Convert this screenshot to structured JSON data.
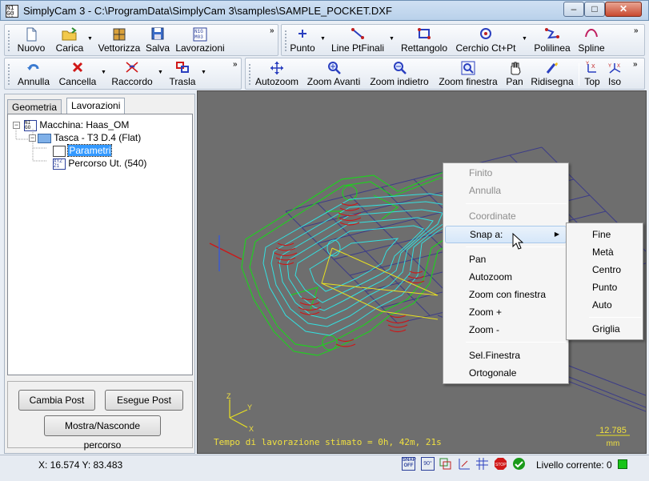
{
  "window": {
    "title": "SimplyCam 3 - C:\\ProgramData\\SimplyCam 3\\samples\\SAMPLE_POCKET.DXF",
    "minimize": "–",
    "maximize": "□",
    "close": "✕"
  },
  "toolbar_file": {
    "items": [
      {
        "label": "Nuovo",
        "icon": "new-file-icon"
      },
      {
        "label": "Carica",
        "icon": "open-folder-icon"
      },
      {
        "label": "Vettorizza",
        "icon": "vectorize-icon"
      },
      {
        "label": "Salva",
        "icon": "save-disk-icon"
      },
      {
        "label": "Lavorazioni",
        "icon": "gcode-icon"
      }
    ]
  },
  "toolbar_draw": {
    "items": [
      {
        "label": "Punto",
        "icon": "point-icon"
      },
      {
        "label": "Line PtFinali",
        "icon": "line-icon"
      },
      {
        "label": "Rettangolo",
        "icon": "rectangle-icon"
      },
      {
        "label": "Cerchio Ct+Pt",
        "icon": "circle-icon"
      },
      {
        "label": "Polilinea",
        "icon": "polyline-icon"
      },
      {
        "label": "Spline",
        "icon": "spline-icon"
      }
    ]
  },
  "toolbar_edit": {
    "items": [
      {
        "label": "Annulla",
        "icon": "undo-icon"
      },
      {
        "label": "Cancella",
        "icon": "delete-icon"
      },
      {
        "label": "Raccordo",
        "icon": "fillet-icon"
      },
      {
        "label": "Trasla",
        "icon": "translate-icon"
      }
    ]
  },
  "toolbar_view": {
    "items": [
      {
        "label": "Autozoom",
        "icon": "autozoom-icon"
      },
      {
        "label": "Zoom Avanti",
        "icon": "zoom-in-icon"
      },
      {
        "label": "Zoom indietro",
        "icon": "zoom-out-icon"
      },
      {
        "label": "Zoom finestra",
        "icon": "zoom-window-icon"
      },
      {
        "label": "Pan",
        "icon": "pan-hand-icon"
      },
      {
        "label": "Ridisegna",
        "icon": "redraw-icon"
      },
      {
        "label": "Top",
        "icon": "top-view-icon"
      },
      {
        "label": "Iso",
        "icon": "iso-view-icon"
      }
    ]
  },
  "tabs": [
    "Geometria",
    "Lavorazioni"
  ],
  "tree": {
    "machine": "Macchina: Haas_OM",
    "pocket": "Tasca - T3 D.4 (Flat)",
    "params": "Parametri",
    "toolpath": "Percorso Ut. (540)"
  },
  "panel_buttons": {
    "change_post": "Cambia Post",
    "run_post": "Esegue Post",
    "toggle_path": "Mostra/Nasconde percorso"
  },
  "viewport": {
    "machining_time": "Tempo di lavorazione stimato = 0h, 42m, 21s",
    "scale_value": "12.785",
    "scale_unit": "mm",
    "axis_x": "X",
    "axis_y": "Y",
    "axis_z": "Z"
  },
  "context_menu": {
    "finito": "Finito",
    "annulla": "Annulla",
    "coordinate": "Coordinate",
    "snap": "Snap a:",
    "pan": "Pan",
    "autozoom": "Autozoom",
    "zoom_window": "Zoom con finestra",
    "zoom_plus": "Zoom +",
    "zoom_minus": "Zoom -",
    "sel_window": "Sel.Finestra",
    "orthogonal": "Ortogonale"
  },
  "snap_menu": {
    "fine": "Fine",
    "meta": "Metà",
    "centro": "Centro",
    "punto": "Punto",
    "auto": "Auto",
    "griglia": "Griglia"
  },
  "status": {
    "coords": "X: 16.574 Y: 83.483",
    "snap_off": "SNAP OFF",
    "ortho": "90°",
    "level": "Livello corrente: 0",
    "level_color": "#18c418"
  },
  "colors": {
    "viewport_bg": "#6e6e6e",
    "contour_green": "#22cc22",
    "path_cyan": "#33e0e0",
    "plunge_red": "#cc1818",
    "link_yellow": "#e8e020",
    "grid": "#3c3c88"
  }
}
